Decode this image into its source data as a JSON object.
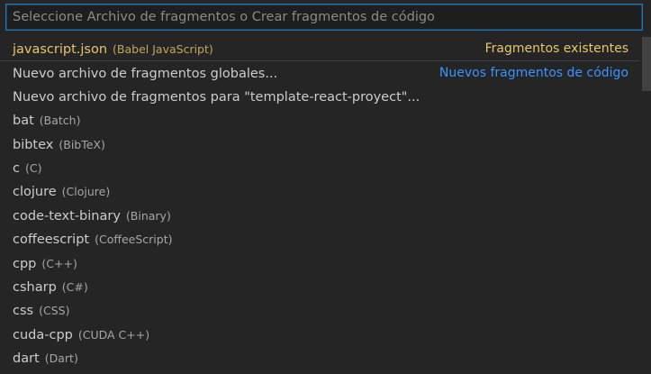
{
  "search": {
    "placeholder": "Seleccione Archivo de fragmentos o Crear fragmentos de código",
    "value": ""
  },
  "items": [
    {
      "label": "javascript.json",
      "desc": "(Babel JavaScript)",
      "group": "Fragmentos existentes",
      "highlight": true
    },
    {
      "label": "Nuevo archivo de fragmentos globales...",
      "desc": "",
      "group": "Nuevos fragmentos de código",
      "groupStart": true
    },
    {
      "label": "Nuevo archivo de fragmentos para \"template-react-proyect\"...",
      "desc": ""
    },
    {
      "label": "bat",
      "desc": "(Batch)"
    },
    {
      "label": "bibtex",
      "desc": "(BibTeX)"
    },
    {
      "label": "c",
      "desc": "(C)"
    },
    {
      "label": "clojure",
      "desc": "(Clojure)"
    },
    {
      "label": "code-text-binary",
      "desc": "(Binary)"
    },
    {
      "label": "coffeescript",
      "desc": "(CoffeeScript)"
    },
    {
      "label": "cpp",
      "desc": "(C++)"
    },
    {
      "label": "csharp",
      "desc": "(C#)"
    },
    {
      "label": "css",
      "desc": "(CSS)"
    },
    {
      "label": "cuda-cpp",
      "desc": "(CUDA C++)"
    },
    {
      "label": "dart",
      "desc": "(Dart)"
    }
  ],
  "colors": {
    "accent_focus": "#007fd4",
    "highlight_text": "#e9c46a",
    "group_blue": "#3794ff",
    "background": "#252526"
  }
}
